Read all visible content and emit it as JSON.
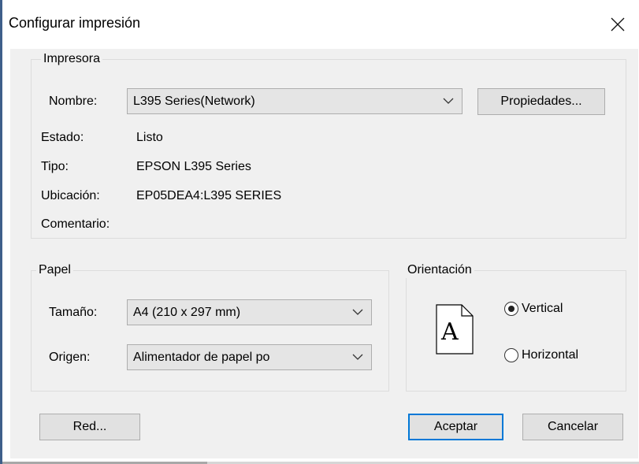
{
  "dialog": {
    "title": "Configurar impresión"
  },
  "printer": {
    "legend": "Impresora",
    "name_label": "Nombre:",
    "name_value": "L395 Series(Network)",
    "properties_button": "Propiedades...",
    "status_label": "Estado:",
    "status_value": "Listo",
    "type_label": "Tipo:",
    "type_value": "EPSON L395 Series",
    "location_label": "Ubicación:",
    "location_value": "EP05DEA4:L395 SERIES",
    "comment_label": "Comentario:",
    "comment_value": ""
  },
  "paper": {
    "legend": "Papel",
    "size_label": "Tamaño:",
    "size_value": "A4 (210 x 297 mm)",
    "source_label": "Origen:",
    "source_value": "Alimentador de papel po"
  },
  "orientation": {
    "legend": "Orientación",
    "portrait_label": "Vertical",
    "landscape_label": "Horizontal",
    "selected": "Vertical",
    "preview_letter": "A"
  },
  "footer": {
    "network_button": "Red...",
    "ok_button": "Aceptar",
    "cancel_button": "Cancelar"
  },
  "colors": {
    "default_button_border": "#0078d7",
    "dialog_background": "#f0f0f0"
  }
}
